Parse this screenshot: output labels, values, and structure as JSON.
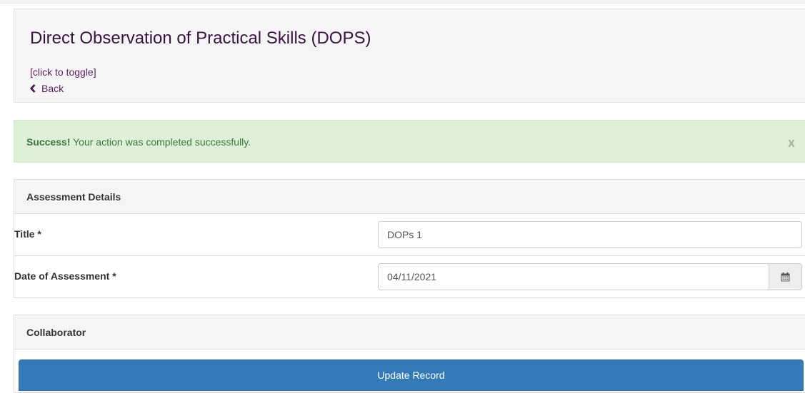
{
  "header": {
    "title": "Direct Observation of Practical Skills (DOPS)",
    "toggle_label": "[click to toggle]",
    "back_label": "Back"
  },
  "alert": {
    "strong": "Success!",
    "message": " Your action was completed successfully.",
    "close_label": "x"
  },
  "assessment": {
    "heading": "Assessment Details",
    "title_label": "Title *",
    "title_value": "DOPs 1",
    "date_label": "Date of Assessment *",
    "date_value": "04/11/2021"
  },
  "collaborator": {
    "heading": "Collaborator"
  },
  "footer": {
    "update_label": "Update Record"
  },
  "icons": {
    "back": "chevron-left-icon",
    "calendar": "calendar-icon"
  },
  "colors": {
    "title": "#3a1441",
    "link": "#5b1f5e",
    "success_bg": "#dff0d8",
    "success_text": "#3c763d",
    "primary": "#337ab7"
  }
}
